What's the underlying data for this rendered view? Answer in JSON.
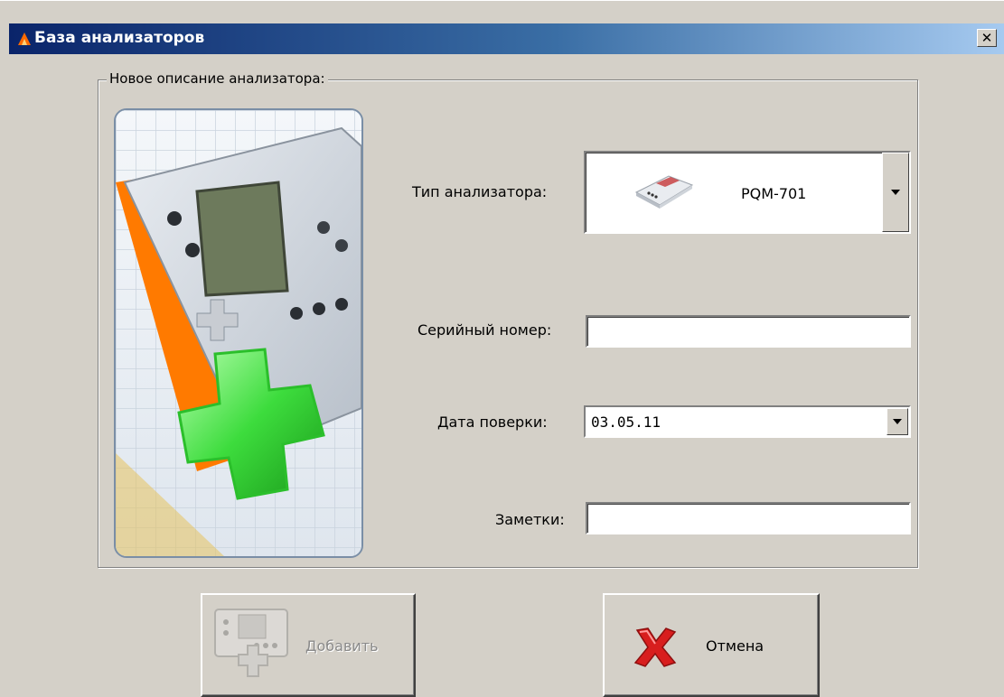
{
  "window": {
    "title": "База анализаторов",
    "close_glyph": "✕"
  },
  "form": {
    "group_title": "Новое описание анализатора:",
    "analyzer_type_label": "Тип анализатора:",
    "analyzer_type_value": "PQM-701",
    "serial_label": "Серийный номер:",
    "serial_value": "",
    "date_label": "Дата поверки:",
    "date_value": "03.05.11",
    "notes_label": "Заметки:",
    "notes_value": ""
  },
  "buttons": {
    "add_label": "Добавить",
    "cancel_label": "Отмена"
  },
  "icons": {
    "app": "app-logo-icon",
    "device": "analyzer-device-icon",
    "add": "analyzer-add-icon",
    "cancel": "red-x-icon",
    "dropdown": "chevron-down-icon"
  },
  "colors": {
    "titlebar_start": "#0a246a",
    "titlebar_end": "#a6caf0",
    "face": "#d4d0c8",
    "plus_green": "#3ddc3d",
    "cancel_red": "#d81e1e",
    "device_orange": "#ff7a00"
  }
}
